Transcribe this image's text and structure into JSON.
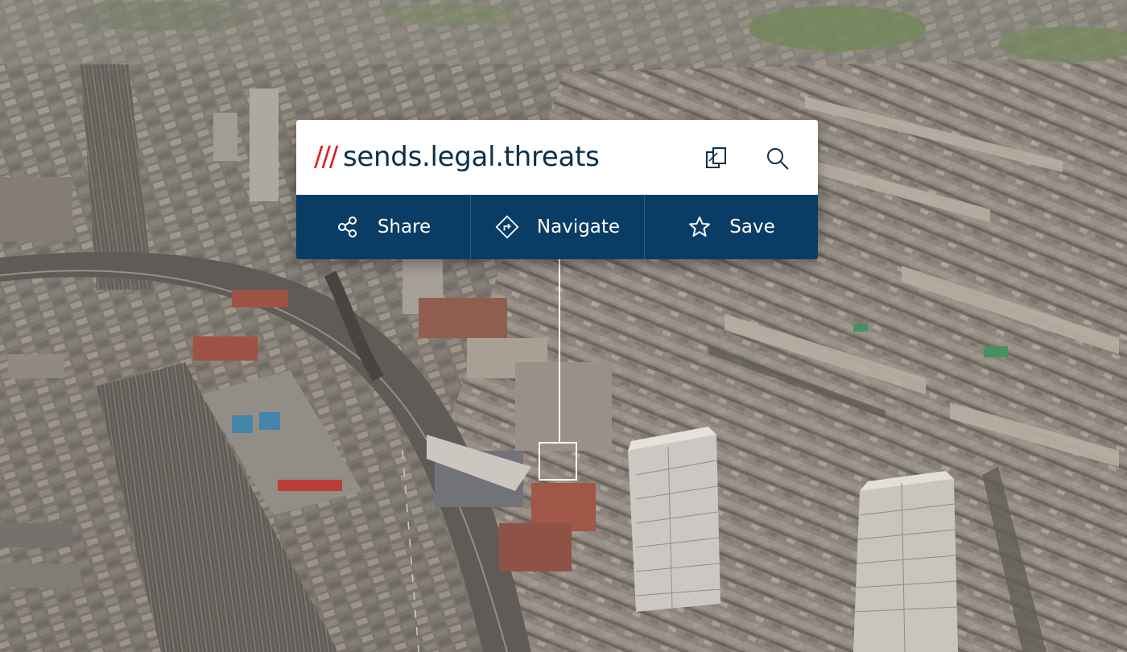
{
  "location": {
    "prefix": "///",
    "words": "sends.legal.threats"
  },
  "toolbar": {
    "copy_icon": "copy-icon",
    "search_icon": "search-icon"
  },
  "actions": [
    {
      "label": "Share",
      "icon": "share-icon"
    },
    {
      "label": "Navigate",
      "icon": "navigate-icon"
    },
    {
      "label": "Save",
      "icon": "star-icon"
    }
  ],
  "colors": {
    "brand_red": "#e11f26",
    "brand_navy": "#0a3d66",
    "text_navy": "#0a3049"
  }
}
